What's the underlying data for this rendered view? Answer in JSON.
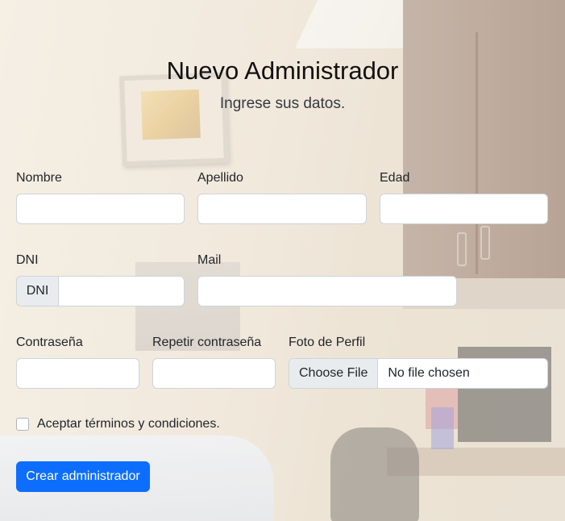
{
  "header": {
    "title": "Nuevo Administrador",
    "subtitle": "Ingrese sus datos."
  },
  "form": {
    "nombre": {
      "label": "Nombre",
      "value": ""
    },
    "apellido": {
      "label": "Apellido",
      "value": ""
    },
    "edad": {
      "label": "Edad",
      "value": ""
    },
    "dni": {
      "label": "DNI",
      "addon": "DNI",
      "value": ""
    },
    "mail": {
      "label": "Mail",
      "value": ""
    },
    "contrasena": {
      "label": "Contraseña",
      "value": ""
    },
    "repetir": {
      "label": "Repetir contraseña",
      "value": ""
    },
    "foto": {
      "label": "Foto de Perfil",
      "button": "Choose File",
      "status": "No file chosen"
    },
    "terms": {
      "label": "Aceptar términos y condiciones.",
      "checked": false
    },
    "submit": {
      "label": "Crear administrador"
    }
  },
  "colors": {
    "primary": "#0d6efd"
  }
}
